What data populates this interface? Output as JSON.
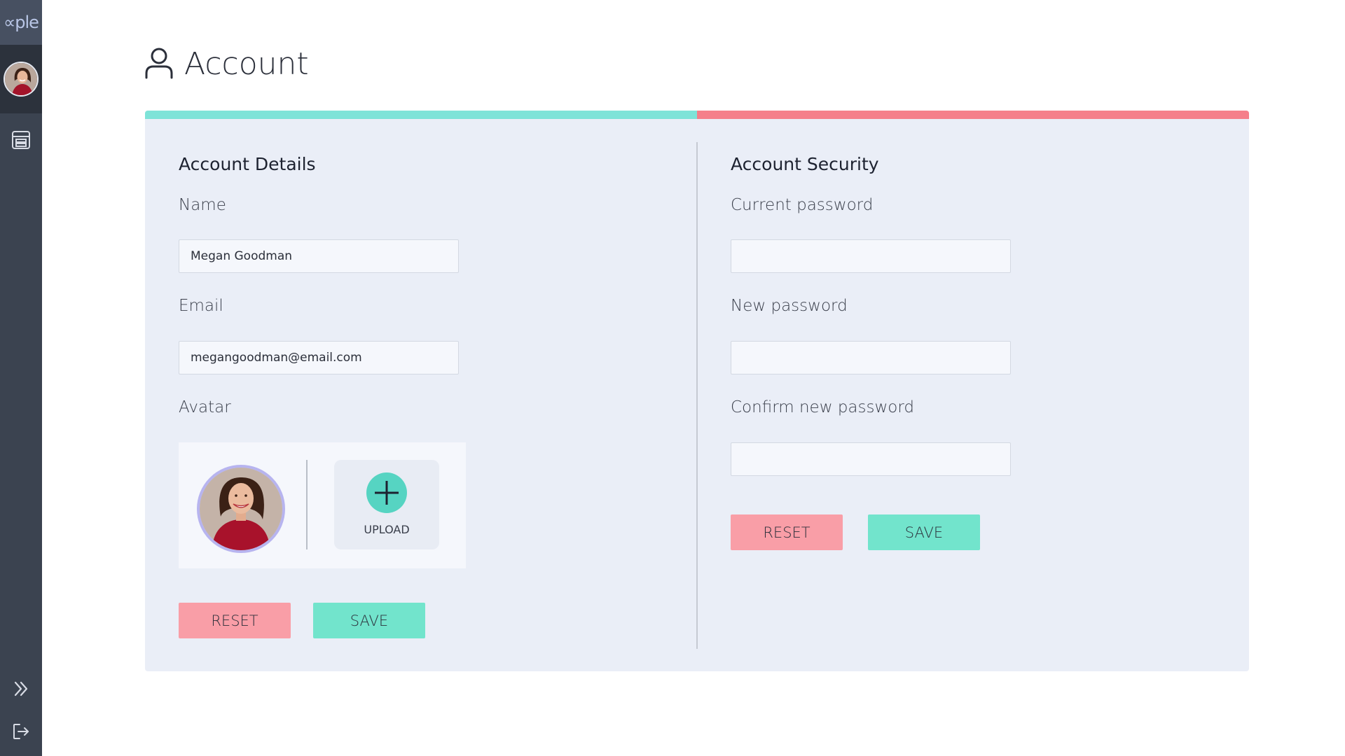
{
  "sidebar": {
    "logo_text": "∝ple",
    "nav_icons": [
      "document-list-icon"
    ],
    "bottom_icons": [
      "double-chevron-right-icon",
      "logout-icon"
    ]
  },
  "header": {
    "title": "Account",
    "icon": "user-icon"
  },
  "colors": {
    "accent_teal": "#7ee3d8",
    "accent_red": "#f57f8a",
    "reset_button": "#f99ea7",
    "save_button": "#72e4cc",
    "sidebar": "#3b4350"
  },
  "details": {
    "title": "Account Details",
    "name_label": "Name",
    "name_value": "Megan Goodman",
    "email_label": "Email",
    "email_value": "megangoodman@email.com",
    "avatar_label": "Avatar",
    "upload_label": "UPLOAD",
    "reset_label": "RESET",
    "save_label": "SAVE"
  },
  "security": {
    "title": "Account Security",
    "current_password_label": "Current password",
    "new_password_label": "New password",
    "confirm_password_label": "Confirm new password",
    "reset_label": "RESET",
    "save_label": "SAVE"
  }
}
